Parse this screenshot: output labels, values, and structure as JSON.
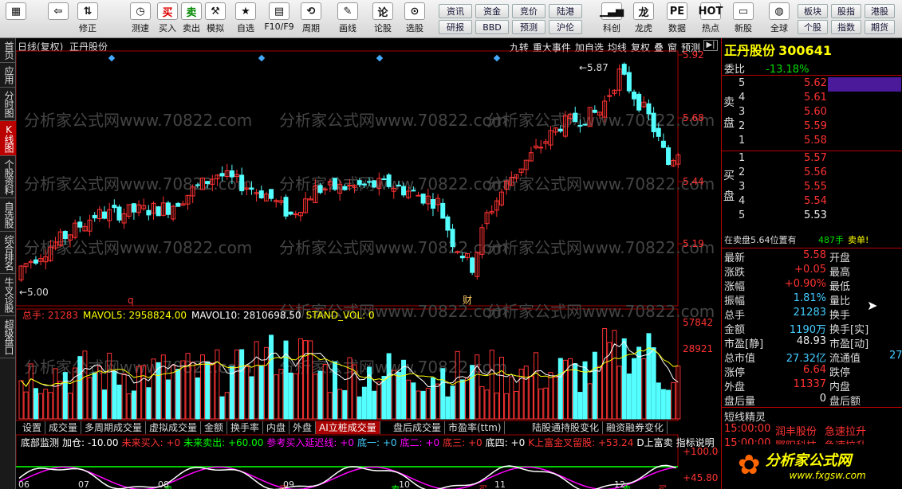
{
  "toolbar": {
    "buttons": [
      {
        "label": "",
        "icon": "grid-icon"
      },
      {
        "label": "",
        "icon": "back-arrow-icon"
      },
      {
        "label": "修正",
        "icon": "up-down-icon"
      },
      {
        "label": "测速",
        "icon": "clock-icon"
      },
      {
        "label": "测速",
        "icon": "clock-icon"
      },
      {
        "label": "买入",
        "icon": "buy-icon",
        "glyph": "买"
      },
      {
        "label": "卖出",
        "icon": "sell-icon",
        "glyph": "卖"
      },
      {
        "label": "模拟",
        "icon": "hammer-icon"
      },
      {
        "label": "自选",
        "icon": "star-icon"
      },
      {
        "label": "F10/F9",
        "icon": "f10-icon"
      },
      {
        "label": "周期",
        "icon": "period-icon"
      },
      {
        "label": "画线",
        "icon": "pencil-icon"
      },
      {
        "label": "论股",
        "icon": "forum-icon"
      },
      {
        "label": "选股",
        "icon": "select-stock-icon"
      }
    ],
    "grid_buttons": [
      [
        "资讯",
        "资金",
        "竞价",
        "陆港"
      ],
      [
        "研报",
        "BBD",
        "预测",
        "沪伦"
      ]
    ],
    "right_buttons": [
      {
        "label": "科创",
        "icon": "chart-icon"
      },
      {
        "label": "龙虎",
        "icon": "dragon-icon"
      },
      {
        "label": "数据",
        "icon": "pe-icon"
      },
      {
        "label": "热点",
        "icon": "hot-icon"
      },
      {
        "label": "新股",
        "icon": "new-stock-icon"
      },
      {
        "label": "全球",
        "icon": "globe-icon"
      }
    ],
    "far_right": [
      [
        "板块",
        "股指",
        "港股"
      ],
      [
        "个股",
        "指数",
        "期货"
      ]
    ]
  },
  "left_tabs": [
    "首页",
    "应用",
    "分时图",
    "K线图",
    "个股资料",
    "自选股",
    "综合排名",
    "牛叉诊股",
    "超级盘口"
  ],
  "chart_header": {
    "title": "日线(复权)",
    "stock": "正丹股份",
    "menu": [
      "九转",
      "重大事件",
      "加自选",
      "均线",
      "复权",
      "叠",
      "窗",
      "预测"
    ]
  },
  "price_axis": [
    "5.92",
    "5.68",
    "5.44",
    "5.19"
  ],
  "peak_label": "5.87",
  "low_label": "5.00",
  "marker_q": "q",
  "marker_cai": "财",
  "watermark": "分析家公式网www.70822.com",
  "volume_header": {
    "total": "总手: 21283",
    "mavol5": "MAVOL5: 2958824.00",
    "mavol10": "MAVOL10: 2810698.50",
    "stand": "STAND_VOL: 0"
  },
  "volume_axis": [
    "57842",
    "28921"
  ],
  "indicator_tabs": [
    "设置",
    "成交量",
    "多周期成交量",
    "虚拟成交量",
    "金额",
    "换手率",
    "内盘",
    "外盘",
    "AI立桩成交量",
    "盘后成交量",
    "市盈率(ttm)",
    "陆股通持股变化",
    "融资融券变化"
  ],
  "indicator_header": {
    "name": "底部监测",
    "text1": "加仓: -10.00",
    "text2": "未来买入: +0",
    "text3": "未来卖出: +60.00",
    "text4": "参考买入延迟线: +0",
    "text5": "底一: +0",
    "text6": "底二: +0",
    "text7": "底三: +0",
    "text8": "底四: +0",
    "text9": "K上富金叉留股: +53.24",
    "btn1": "D上富卖",
    "btn2": "指标说明"
  },
  "ind_axis": [
    "+100.0",
    "+45.80"
  ],
  "months": [
    "06",
    "07",
    "08",
    "09",
    "10",
    "11",
    "12"
  ],
  "sell_label": "卖",
  "buy_label": "买",
  "quote": {
    "name": "正丹股份",
    "code": "300641",
    "webi_label": "委比",
    "webi_val": "-13.18%",
    "sell": [
      {
        "n": "5",
        "p": "5.62"
      },
      {
        "n": "4",
        "p": "5.61"
      },
      {
        "n": "3",
        "p": "5.60"
      },
      {
        "n": "2",
        "p": "5.59"
      },
      {
        "n": "1",
        "p": "5.58"
      }
    ],
    "buy": [
      {
        "n": "1",
        "p": "5.57"
      },
      {
        "n": "2",
        "p": "5.56"
      },
      {
        "n": "3",
        "p": "5.55"
      },
      {
        "n": "4",
        "p": "5.54"
      },
      {
        "n": "5",
        "p": "5.53"
      }
    ],
    "sell_side": "卖盘",
    "buy_side": "买盘",
    "pos": "在卖盘5.64位置有",
    "pos_qty": "487手",
    "pos_act": "卖单!",
    "stats": [
      {
        "l": "最新",
        "v": "5.58",
        "l2": "开盘",
        "c": "red"
      },
      {
        "l": "涨跌",
        "v": "+0.05",
        "l2": "最高",
        "c": "red"
      },
      {
        "l": "涨幅",
        "v": "+0.90%",
        "l2": "最低",
        "c": "red"
      },
      {
        "l": "振幅",
        "v": "1.81%",
        "l2": "量比",
        "c": "cyan"
      },
      {
        "l": "总手",
        "v": "21283",
        "l2": "换手",
        "c": "cyan"
      },
      {
        "l": "金额",
        "v": "1190万",
        "l2": "换手[实]",
        "c": "cyan"
      },
      {
        "l": "市盈[静]",
        "v": "48.93",
        "l2": "市盈[动]",
        "c": "white"
      },
      {
        "l": "总市值",
        "v": "27.32亿",
        "l2": "流通值",
        "c": "cyan"
      },
      {
        "l": "涨停",
        "v": "6.64",
        "l2": "跌停",
        "c": "red"
      },
      {
        "l": "外盘",
        "v": "11337",
        "l2": "内盘",
        "c": "red"
      },
      {
        "l": "盘后量",
        "v": "0",
        "l2": "盘后额",
        "c": "white"
      }
    ],
    "liutong_extra": "27",
    "short_title": "短线精灵",
    "short": [
      {
        "t": "15:00:00",
        "s": "润丰股份",
        "e": "急速拉升"
      },
      {
        "t": "15:00:00",
        "s": "鄂阳科技",
        "e": "急速拉升"
      }
    ],
    "logo": "分析家公式网",
    "logo_url": "www.fxgsw.com"
  },
  "colors": {
    "up": "#ff3232",
    "down": "#54ffff",
    "bg": "#000000",
    "accent": "#b00000"
  }
}
